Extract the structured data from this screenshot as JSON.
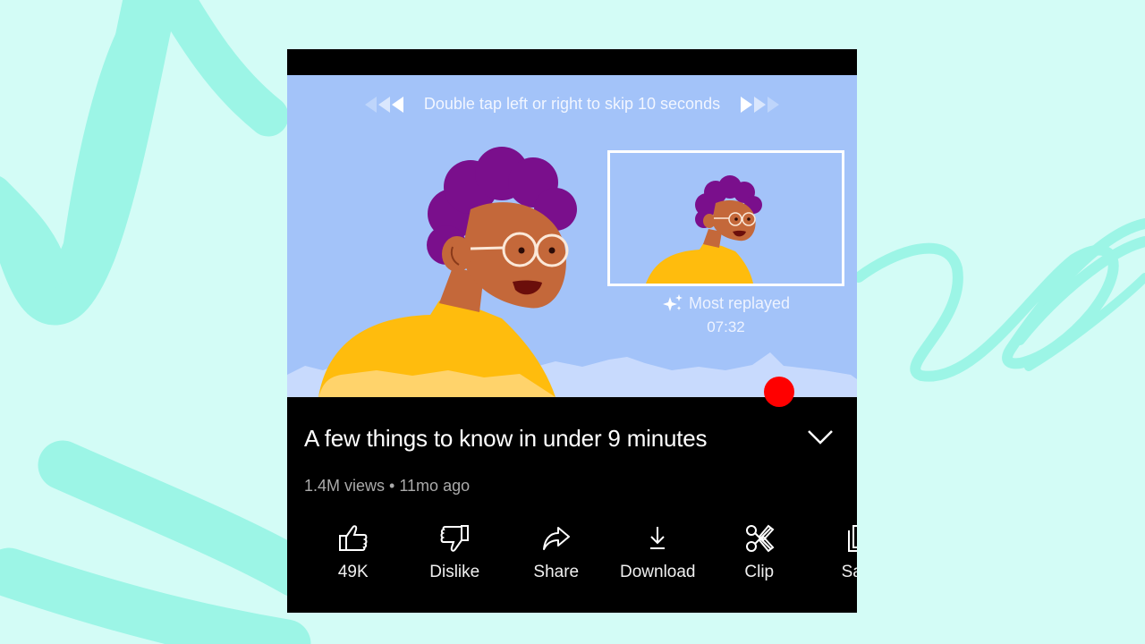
{
  "colors": {
    "page_background": "#d3fcf6",
    "brush_strokes": "#9cf5e6",
    "video_background": "#a3c3f9",
    "progress_played": "#e2231a",
    "progress_knob": "#ff0000",
    "panel_background": "#000000",
    "hair": "#7a0f8c",
    "skin": "#c4683a",
    "shirt": "#ffbc0d"
  },
  "player": {
    "skip_hint": "Double tap left or right to skip 10 seconds",
    "skip_back_icon": "rewind-triangles-icon",
    "skip_forward_icon": "fast-forward-triangles-icon",
    "preview": {
      "label": "Most replayed",
      "icon": "sparkle-icon",
      "timestamp": "07:32"
    },
    "progress_fraction": 0.8,
    "buffered_fraction": 1.0
  },
  "video": {
    "title": "A few things to know in under 9 minutes",
    "expand_icon": "chevron-down-icon",
    "views": "1.4M views",
    "separator": "•",
    "age": "11mo ago"
  },
  "actions": [
    {
      "icon": "thumbs-up-icon",
      "label": "49K"
    },
    {
      "icon": "thumbs-down-icon",
      "label": "Dislike"
    },
    {
      "icon": "share-icon",
      "label": "Share"
    },
    {
      "icon": "download-icon",
      "label": "Download"
    },
    {
      "icon": "scissors-icon",
      "label": "Clip"
    },
    {
      "icon": "save-playlist-icon",
      "label": "Save"
    }
  ]
}
